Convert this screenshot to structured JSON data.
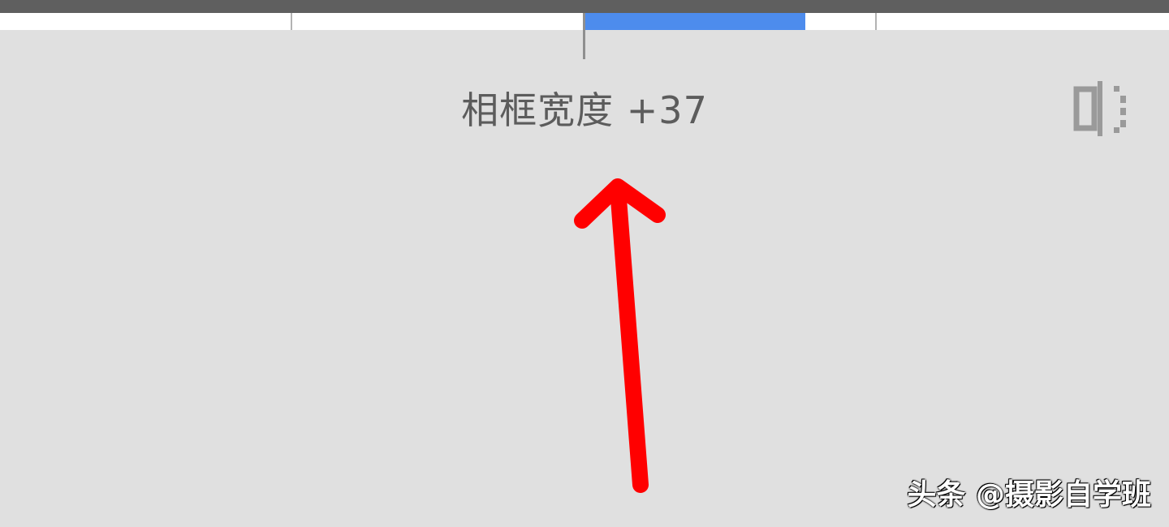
{
  "slider": {
    "value": 37,
    "fill_color": "#4d8ced"
  },
  "parameter": {
    "label": "相框宽度 +37"
  },
  "icons": {
    "compare": "split-compare-icon",
    "arrow": "red-arrow-annotation"
  },
  "annotation": {
    "color": "#ff0000"
  },
  "watermark": {
    "text": "头条 @摄影自学班"
  }
}
